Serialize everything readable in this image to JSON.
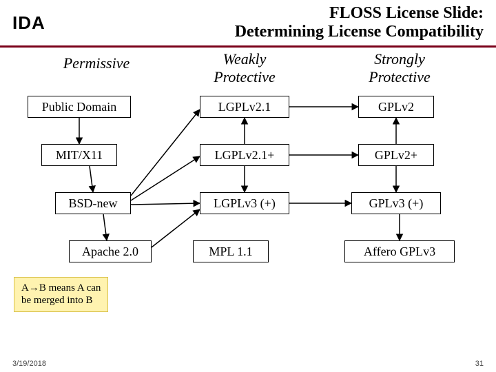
{
  "logo": "IDA",
  "title": {
    "line1": "FLOSS License Slide:",
    "line2": "Determining License Compatibility"
  },
  "columns": {
    "permissive": "Permissive",
    "weak": "Weakly Protective",
    "strong": "Strongly Protective"
  },
  "licenses": {
    "public_domain": "Public Domain",
    "mit": "MIT/X11",
    "bsd": "BSD-new",
    "apache": "Apache 2.0",
    "lgpl21": "LGPLv2.1",
    "lgpl21p": "LGPLv2.1+",
    "lgpl3": "LGPLv3 (+)",
    "mpl": "MPL 1.1",
    "gpl2": "GPLv2",
    "gpl2p": "GPLv2+",
    "gpl3": "GPLv3 (+)",
    "affero": "Affero GPLv3"
  },
  "legend": {
    "line1": "A→B means A can",
    "line2": "be merged into B"
  },
  "footer": {
    "date": "3/19/2018",
    "page": "31"
  },
  "chart_data": {
    "type": "diagram",
    "title": "FLOSS License Slide: Determining License Compatibility",
    "columns": [
      "Permissive",
      "Weakly Protective",
      "Strongly Protective"
    ],
    "nodes": [
      {
        "id": "public_domain",
        "label": "Public Domain",
        "col": "Permissive",
        "row": 0
      },
      {
        "id": "mit",
        "label": "MIT/X11",
        "col": "Permissive",
        "row": 1
      },
      {
        "id": "bsd",
        "label": "BSD-new",
        "col": "Permissive",
        "row": 2
      },
      {
        "id": "apache",
        "label": "Apache 2.0",
        "col": "Permissive",
        "row": 3
      },
      {
        "id": "lgpl21",
        "label": "LGPLv2.1",
        "col": "Weakly Protective",
        "row": 0
      },
      {
        "id": "lgpl21p",
        "label": "LGPLv2.1+",
        "col": "Weakly Protective",
        "row": 1
      },
      {
        "id": "lgpl3",
        "label": "LGPLv3 (+)",
        "col": "Weakly Protective",
        "row": 2
      },
      {
        "id": "mpl",
        "label": "MPL 1.1",
        "col": "Weakly Protective",
        "row": 3
      },
      {
        "id": "gpl2",
        "label": "GPLv2",
        "col": "Strongly Protective",
        "row": 0
      },
      {
        "id": "gpl2p",
        "label": "GPLv2+",
        "col": "Strongly Protective",
        "row": 1
      },
      {
        "id": "gpl3",
        "label": "GPLv3 (+)",
        "col": "Strongly Protective",
        "row": 2
      },
      {
        "id": "affero",
        "label": "Affero GPLv3",
        "col": "Strongly Protective",
        "row": 3
      }
    ],
    "edges": [
      {
        "from": "public_domain",
        "to": "mit"
      },
      {
        "from": "mit",
        "to": "bsd"
      },
      {
        "from": "bsd",
        "to": "apache"
      },
      {
        "from": "bsd",
        "to": "lgpl21"
      },
      {
        "from": "bsd",
        "to": "lgpl21p"
      },
      {
        "from": "bsd",
        "to": "lgpl3"
      },
      {
        "from": "apache",
        "to": "lgpl3"
      },
      {
        "from": "lgpl21p",
        "to": "lgpl21"
      },
      {
        "from": "lgpl21p",
        "to": "lgpl3"
      },
      {
        "from": "lgpl21",
        "to": "gpl2"
      },
      {
        "from": "lgpl21p",
        "to": "gpl2p"
      },
      {
        "from": "lgpl3",
        "to": "gpl3"
      },
      {
        "from": "gpl2p",
        "to": "gpl2"
      },
      {
        "from": "gpl2p",
        "to": "gpl3"
      },
      {
        "from": "gpl3",
        "to": "affero"
      }
    ],
    "legend": "A→B means A can be merged into B"
  }
}
